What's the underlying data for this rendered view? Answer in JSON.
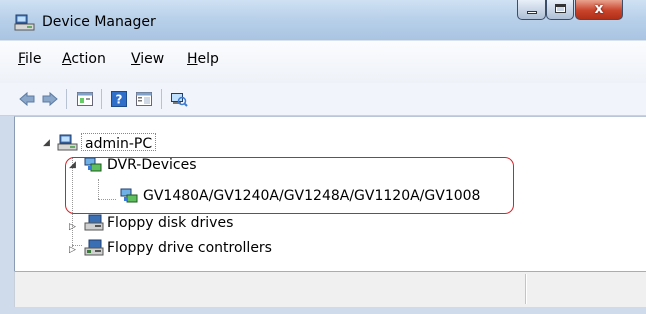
{
  "window": {
    "title": "Device Manager"
  },
  "menu": [
    {
      "accel": "F",
      "rest": "ile"
    },
    {
      "accel": "A",
      "rest": "ction"
    },
    {
      "accel": "V",
      "rest": "iew"
    },
    {
      "accel": "H",
      "rest": "elp"
    }
  ],
  "toolbar": [
    "back-icon",
    "forward-icon",
    "properties-icon",
    "help-icon",
    "show-hide-console-tree-icon",
    "scan-hardware-icon"
  ],
  "tree": {
    "root": "admin-PC",
    "dvr_category": "DVR-Devices",
    "dvr_device": "GV1480A/GV1240A/GV1248A/GV1120A/GV1008",
    "floppy_disk": "Floppy disk drives",
    "floppy_controller": "Floppy drive controllers"
  },
  "colors": {
    "highlight": "#d2232a",
    "titlebar": "#b9d1ea",
    "close_button": "#c8442b"
  }
}
